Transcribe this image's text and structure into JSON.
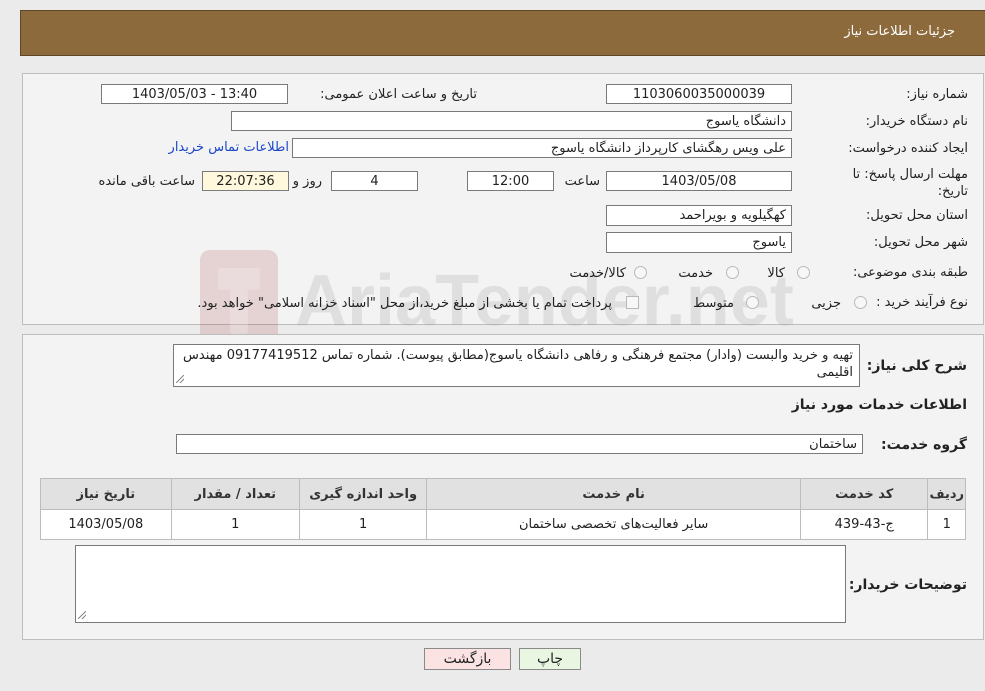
{
  "header": {
    "title": "جزئیات اطلاعات نیاز"
  },
  "watermark": {
    "text": "AriaTender.net"
  },
  "form": {
    "need_number_label": "شماره نیاز:",
    "need_number": "1103060035000039",
    "announce_label": "تاریخ و ساعت اعلان عمومی:",
    "announce_value": "1403/05/03 - 13:40",
    "buyer_org_label": "نام دستگاه خریدار:",
    "buyer_org": "دانشگاه یاسوج",
    "creator_label": "ایجاد کننده درخواست:",
    "creator": "علی ویس رهگشای کارپرداز دانشگاه یاسوج",
    "contact_link": "اطلاعات تماس خریدار",
    "deadline_label": "مهلت ارسال پاسخ: تا تاریخ:",
    "deadline_date": "1403/05/08",
    "time_label": "ساعت",
    "deadline_time": "12:00",
    "days": "4",
    "days_label": "روز و",
    "remaining_time": "22:07:36",
    "remaining_label": "ساعت باقی مانده",
    "province_label": "استان محل تحویل:",
    "province": "کهگیلویه و بویراحمد",
    "city_label": "شهر محل تحویل:",
    "city": "یاسوج",
    "category_label": "طبقه بندی موضوعی:",
    "category_options": [
      "کالا",
      "خدمت",
      "کالا/خدمت"
    ],
    "process_label": "نوع فرآیند خرید :",
    "process_options": [
      "جزیی",
      "متوسط"
    ],
    "payment_note": "پرداخت تمام یا بخشی از مبلغ خرید،از محل \"اسناد خزانه اسلامی\" خواهد بود."
  },
  "description": {
    "label": "شرح کلی نیاز:",
    "text": "تهیه و خرید والبست (وادار) مجتمع فرهنگی و رفاهی دانشگاه یاسوج(مطابق پیوست). شماره تماس 09177419512 مهندس اقلیمی"
  },
  "services": {
    "section_title": "اطلاعات خدمات مورد نیاز",
    "group_label": "گروه خدمت:",
    "group_value": "ساختمان",
    "columns": [
      "ردیف",
      "کد خدمت",
      "نام خدمت",
      "واحد اندازه گیری",
      "تعداد / مقدار",
      "تاریخ نیاز"
    ],
    "rows": [
      [
        "1",
        "ج-43-439",
        "سایر فعالیت‌های تخصصی ساختمان",
        "1",
        "1",
        "1403/05/08"
      ]
    ]
  },
  "buyer_notes": {
    "label": "توضیحات خریدار:",
    "value": ""
  },
  "buttons": {
    "print": "چاپ",
    "back": "بازگشت"
  },
  "colors": {
    "header": "#8c6a3c",
    "print_button": "#e9f7e2",
    "back_button": "#fbe3e3",
    "link": "#1b47c9"
  }
}
